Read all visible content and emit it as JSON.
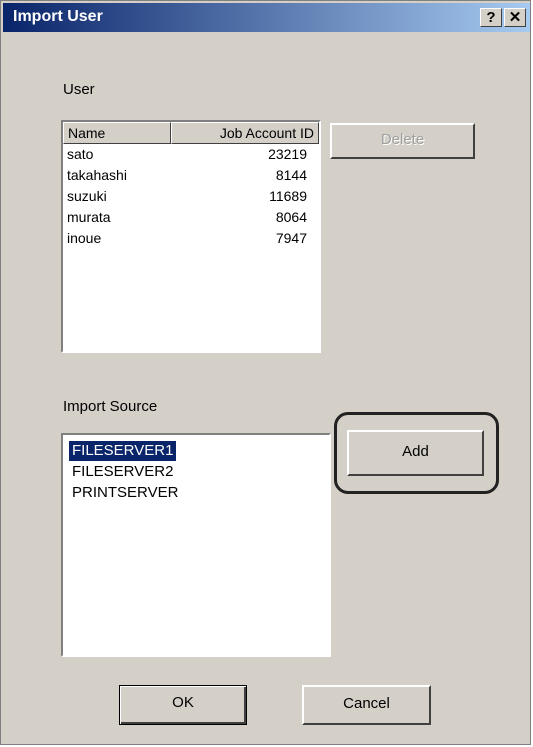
{
  "window": {
    "title": "Import User",
    "help_label": "?",
    "close_label": "✕"
  },
  "user_section": {
    "label": "User",
    "columns": [
      "Name",
      "Job Account ID"
    ],
    "rows": [
      {
        "name": "sato",
        "id": "23219"
      },
      {
        "name": "takahashi",
        "id": "8144"
      },
      {
        "name": "suzuki",
        "id": "11689"
      },
      {
        "name": "murata",
        "id": "8064"
      },
      {
        "name": "inoue",
        "id": "7947"
      }
    ],
    "delete_label": "Delete"
  },
  "import_section": {
    "label": "Import Source",
    "items": [
      "FILESERVER1",
      "FILESERVER2",
      "PRINTSERVER"
    ],
    "selected_index": 0,
    "add_label": "Add"
  },
  "footer": {
    "ok_label": "OK",
    "cancel_label": "Cancel"
  }
}
